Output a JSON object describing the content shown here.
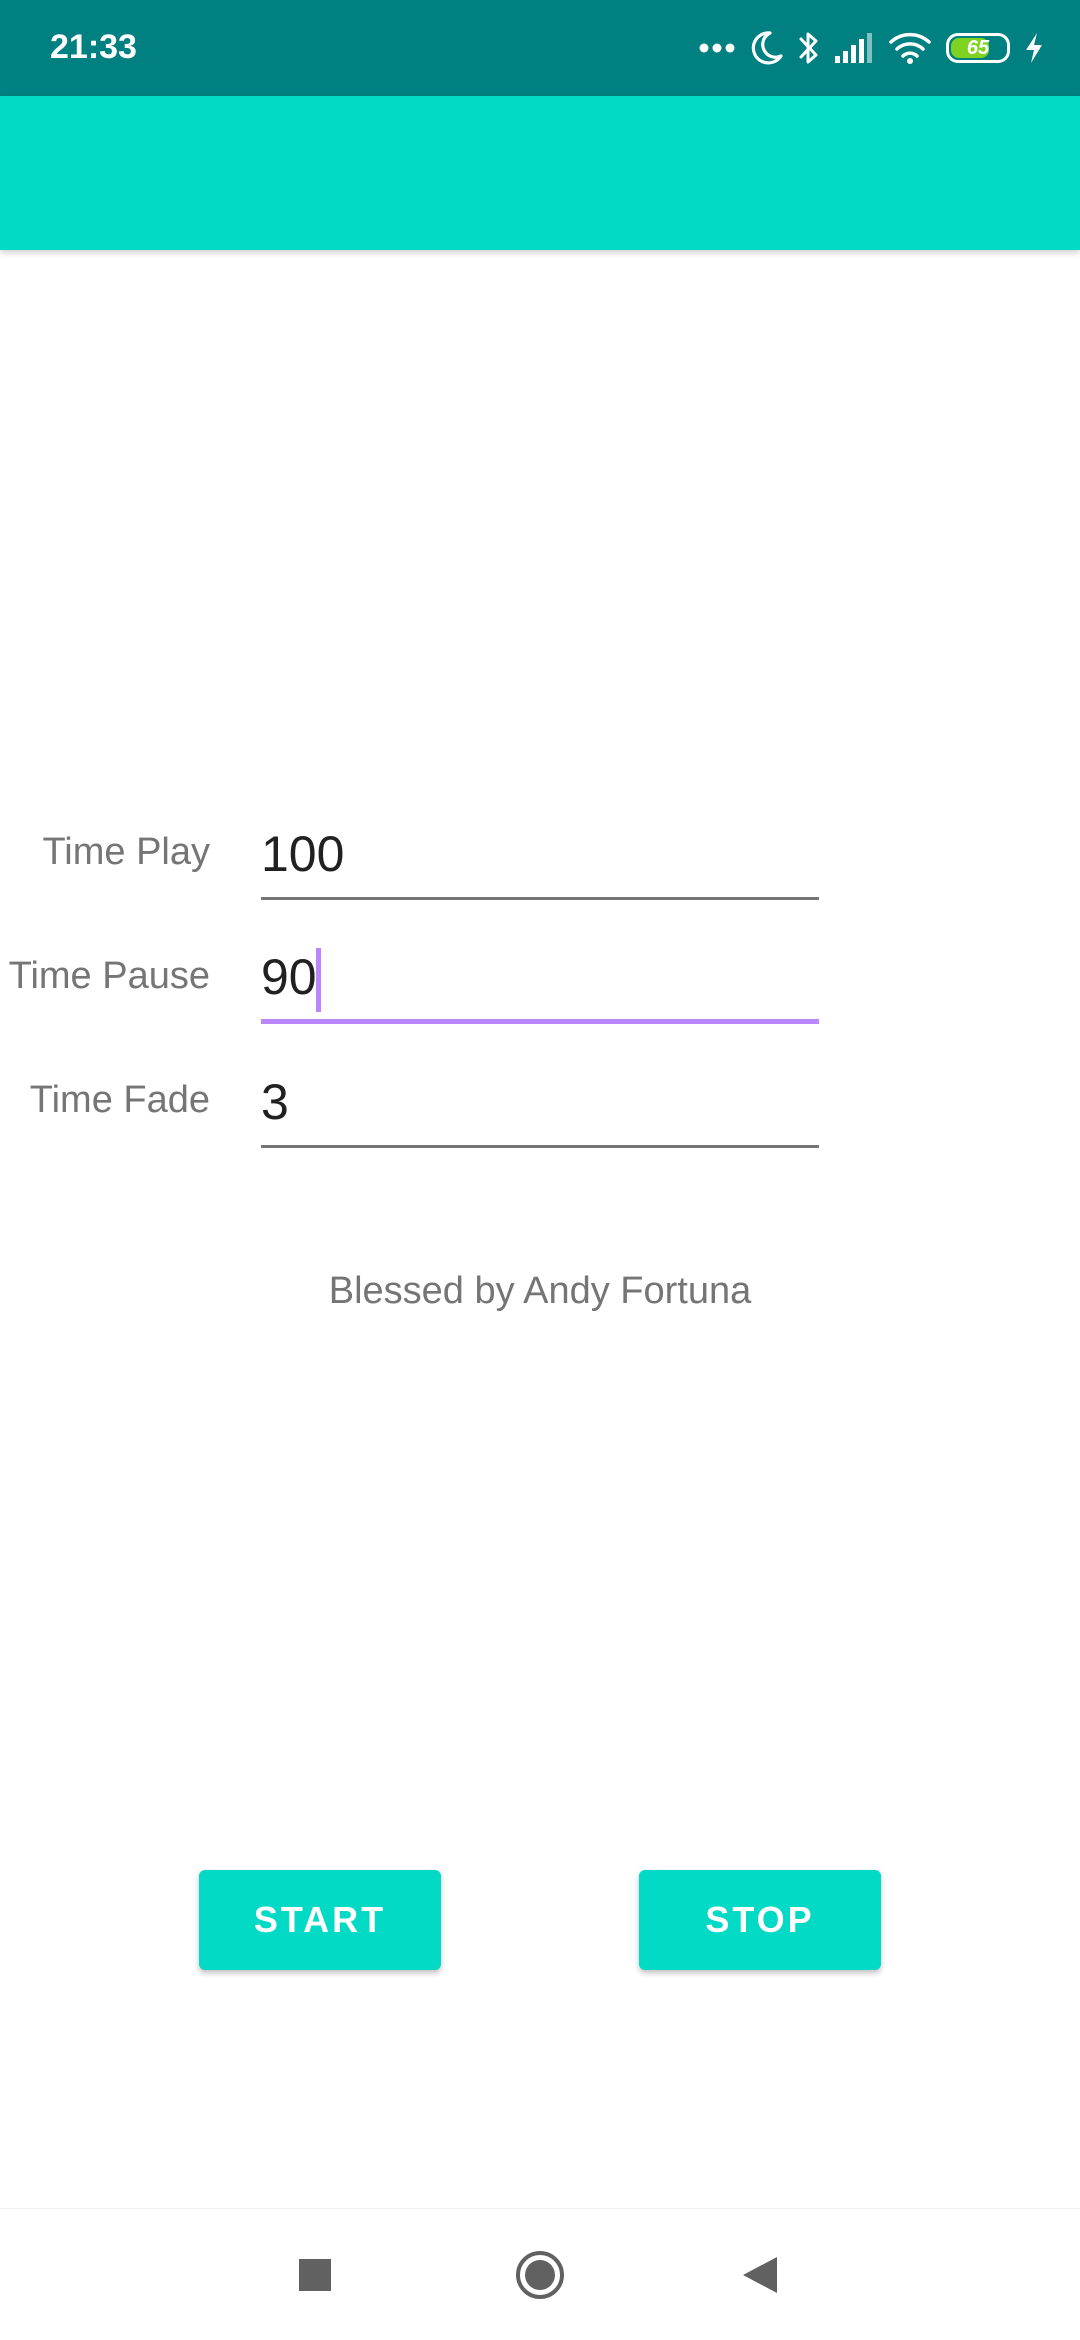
{
  "status_bar": {
    "time": "21:33",
    "battery_level": "65",
    "icons": [
      "more-dots-icon",
      "moon-icon",
      "bluetooth-icon",
      "signal-icon",
      "wifi-icon",
      "battery-icon",
      "charging-bolt-icon"
    ]
  },
  "colors": {
    "status_bar": "#008080",
    "app_bar": "#03dac5",
    "accent": "#bb86fc",
    "label": "#757575",
    "input_text": "#212121"
  },
  "form": {
    "fields": [
      {
        "label": "Time Play",
        "value": "100"
      },
      {
        "label": "Time Pause",
        "value": "90"
      },
      {
        "label": "Time Fade",
        "value": "3"
      }
    ],
    "focused_field": "Time Pause"
  },
  "credit": "Blessed by Andy Fortuna",
  "buttons": {
    "start_label": "START",
    "stop_label": "STOP"
  },
  "nav_bar": {
    "icons": [
      "recents-square-icon",
      "home-circle-icon",
      "back-triangle-icon"
    ]
  }
}
